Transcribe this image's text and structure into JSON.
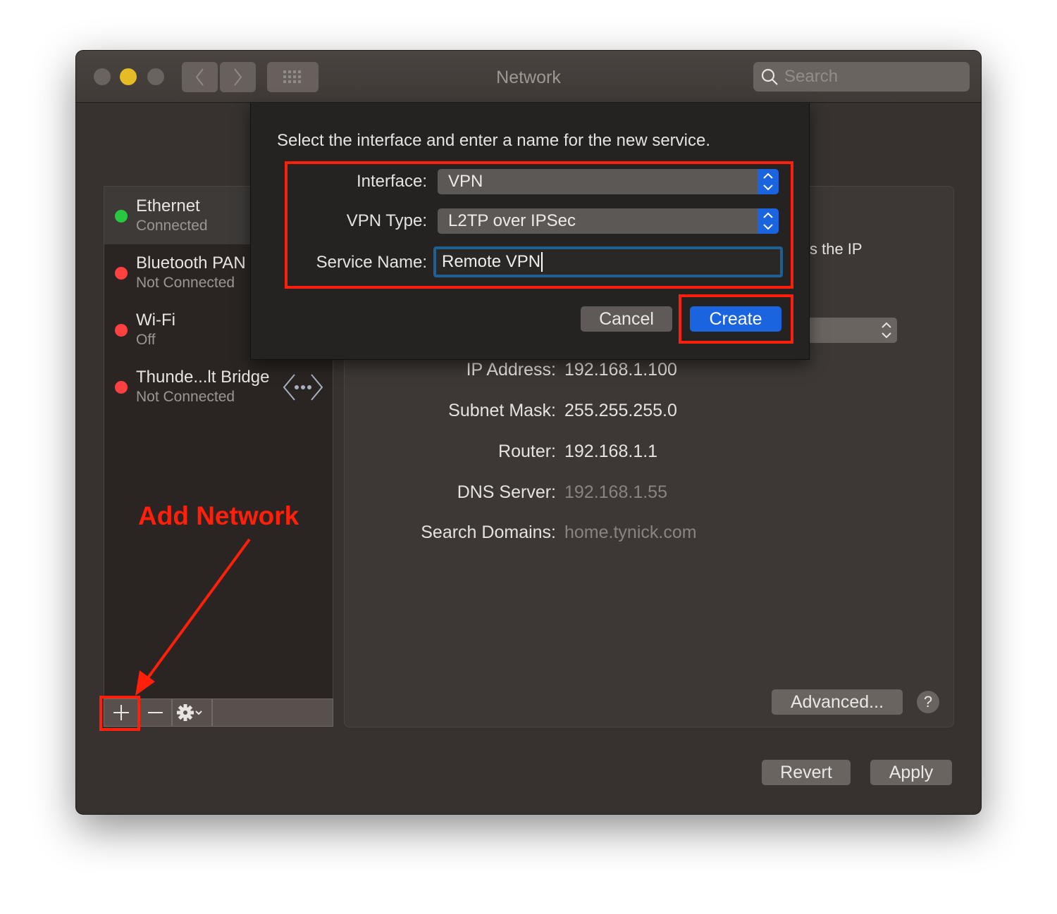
{
  "window": {
    "title": "Network",
    "search_placeholder": "Search",
    "traffic_lights": [
      "close",
      "minimize",
      "zoom"
    ],
    "accent_color": "#1a64e0"
  },
  "sidebar": {
    "services": [
      {
        "name": "Ethernet",
        "status": "Connected",
        "status_color": "#28c840",
        "selected": true
      },
      {
        "name": "Bluetooth PAN",
        "status": "Not Connected",
        "status_color": "#ff4040"
      },
      {
        "name": "Wi-Fi",
        "status": "Off",
        "status_color": "#ff4040"
      },
      {
        "name": "Thunde...lt Bridge",
        "status": "Not Connected",
        "status_color": "#ff4040",
        "icon": "network-ellipsis-icon"
      }
    ],
    "toolbar": {
      "add": "+",
      "remove": "−",
      "action": "gear-icon"
    }
  },
  "panel": {
    "partial_text": "s the IP",
    "fields": [
      {
        "label": "IP Address:",
        "value": "192.168.1.100",
        "dim": false
      },
      {
        "label": "Subnet Mask:",
        "value": "255.255.255.0",
        "dim": false
      },
      {
        "label": "Router:",
        "value": "192.168.1.1",
        "dim": false
      },
      {
        "label": "DNS Server:",
        "value": "192.168.1.55",
        "dim": true
      },
      {
        "label": "Search Domains:",
        "value": "home.tynick.com",
        "dim": true
      }
    ],
    "advanced_label": "Advanced...",
    "help_label": "?",
    "revert_label": "Revert",
    "apply_label": "Apply"
  },
  "sheet": {
    "prompt": "Select the interface and enter a name for the new service.",
    "interface_label": "Interface:",
    "interface_value": "VPN",
    "vpn_type_label": "VPN Type:",
    "vpn_type_value": "L2TP over IPSec",
    "service_name_label": "Service Name:",
    "service_name_value": "Remote VPN",
    "cancel_label": "Cancel",
    "create_label": "Create"
  },
  "annotation": {
    "text": "Add Network",
    "color": "#ff1f0a"
  }
}
